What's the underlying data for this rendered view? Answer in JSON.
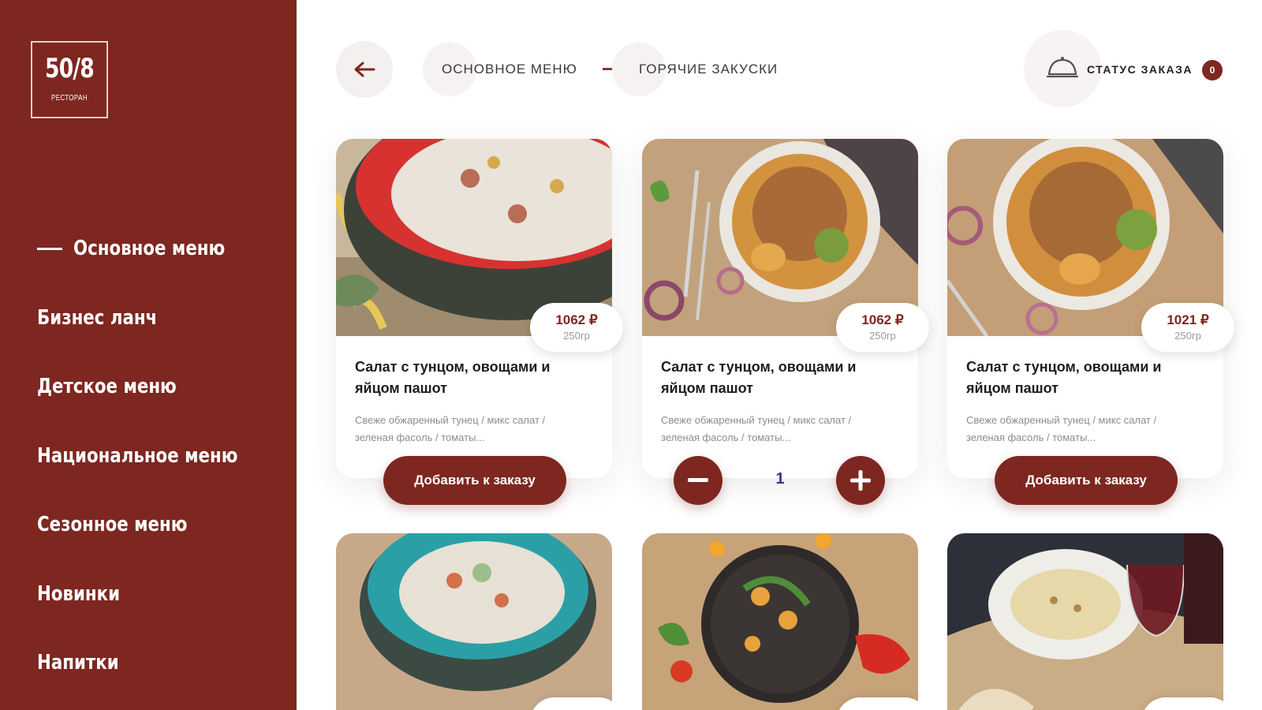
{
  "logo": {
    "main": "50/8",
    "sub": "ресторан"
  },
  "nav": [
    {
      "label": "Основное меню",
      "active": true
    },
    {
      "label": "Бизнес ланч"
    },
    {
      "label": "Детское меню"
    },
    {
      "label": "Национальное меню"
    },
    {
      "label": "Сезонное меню"
    },
    {
      "label": "Новинки"
    },
    {
      "label": "Напитки"
    }
  ],
  "breadcrumb": {
    "first": "ОСНОВНОЕ МЕНЮ",
    "second": "ГОРЯЧИЕ ЗАКУСКИ"
  },
  "order_status": {
    "label": "СТАТУС ЗАКАЗА",
    "count": "0"
  },
  "cards": [
    {
      "price": "1062 ₽",
      "weight": "250гр",
      "title": "Салат с тунцом, овощами и яйцом пашот",
      "desc": "Свеже обжаренный тунец / микс салат / зеленая фасоль / томаты...",
      "button": "Добавить к заказу"
    },
    {
      "price": "1062 ₽",
      "weight": "250гр",
      "title": "Салат с тунцом, овощами и яйцом пашот",
      "desc": "Свеже обжаренный тунец / микс салат / зеленая фасоль / томаты...",
      "quantity": "1"
    },
    {
      "price": "1021 ₽",
      "weight": "250гр",
      "title": "Салат с тунцом, овощами и яйцом пашот",
      "desc": "Свеже обжаренный тунец / микс салат / зеленая фасоль / томаты...",
      "button": "Добавить к заказу"
    }
  ],
  "colors": {
    "brand": "#7d2720",
    "accent_text": "#4a2a8a"
  }
}
